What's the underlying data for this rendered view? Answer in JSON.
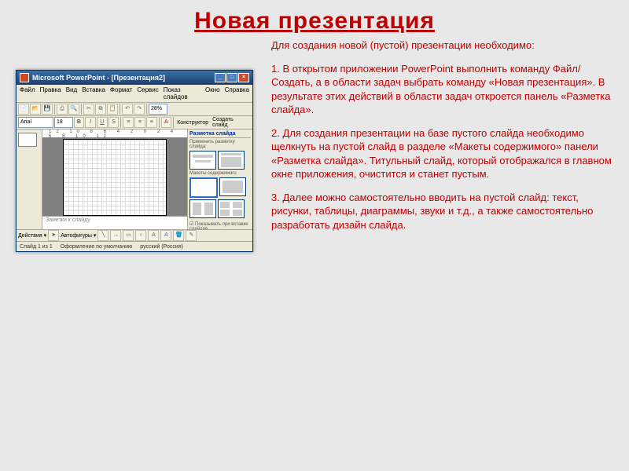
{
  "title": "Новая презентация",
  "intro": "Для создания новой (пустой) презентации необходимо:",
  "step1": "1. В открытом приложении PowerPoint выполнить команду Файл/Создать, а в области задач выбрать команду «Новая презентация». В результате этих действий в области задач откроется панель «Разметка слайда».",
  "step2": "2. Для создания презентации на базе пустого слайда необходимо щелкнуть на пустой слайд в разделе «Макеты содержимого» панели «Разметка слайда». Титульный слайд, который отображался в главном окне приложения, очистится и станет пустым.",
  "step3": "3. Далее можно самостоятельно вводить на пустой слайд: текст, рисунки, таблицы, диаграммы, звуки и т.д., а также самостоятельно разработать дизайн слайда.",
  "pp": {
    "title": "Microsoft PowerPoint - [Презентация2]",
    "menu": [
      "Файл",
      "Правка",
      "Вид",
      "Вставка",
      "Формат",
      "Сервис",
      "Показ слайдов",
      "Окно",
      "Справка"
    ],
    "font": "Arial",
    "fontsize": "18",
    "ruler": "12 10 8 6 4 2 0 2 4 6 8 10 12",
    "notes": "Заметки к слайду",
    "taskpane_title": "Разметка слайда",
    "taskpane_apply": "Применить разметку слайда:",
    "taskpane_section": "Макеты содержимого",
    "taskpane_footer": "Показывать при вставке слайдов",
    "drawbar_actions": "Действия ▾",
    "drawbar_autoshapes": "Автофигуры ▾",
    "status_slide": "Слайд 1 из 1",
    "status_design": "Оформление по умолчанию",
    "status_lang": "русский (Россия)",
    "konstruktor": "Конструктор",
    "create_slide": "Создать слайд"
  }
}
